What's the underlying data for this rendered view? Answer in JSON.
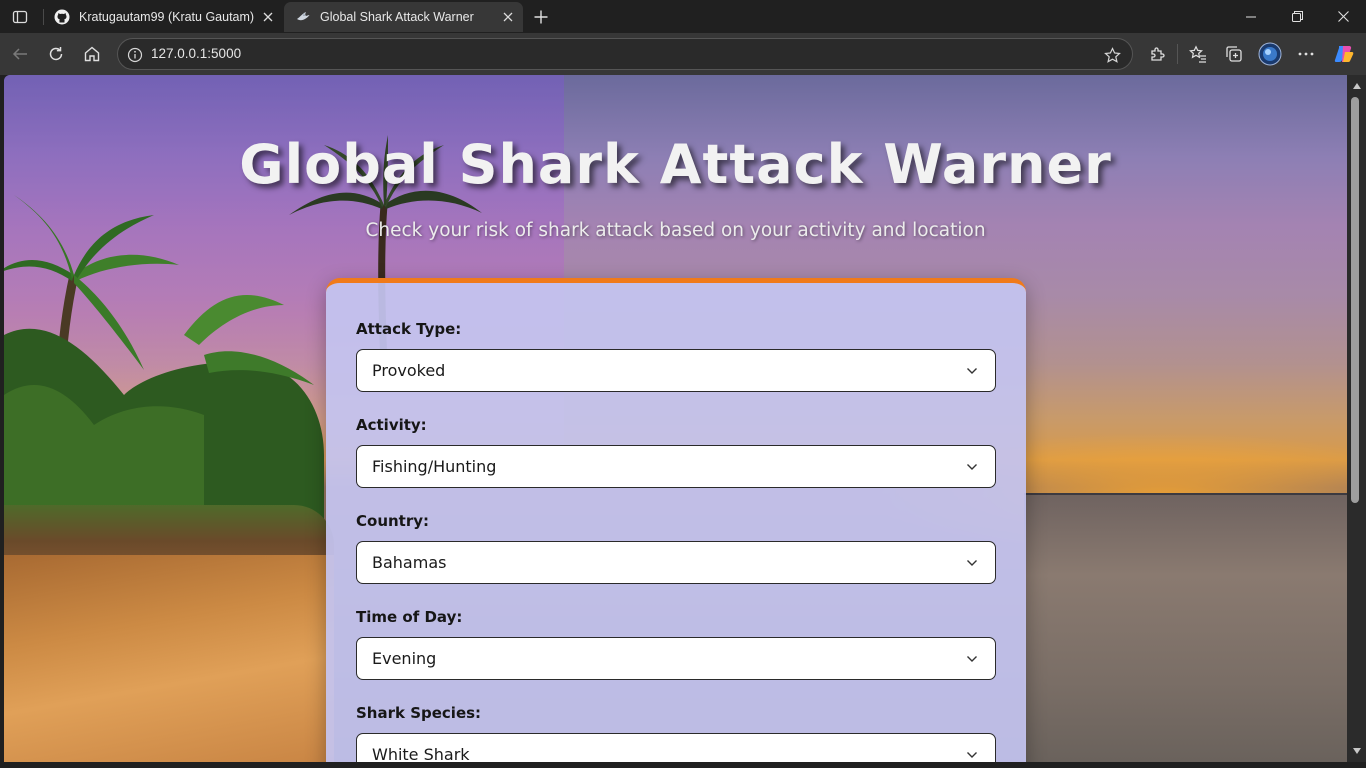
{
  "browser": {
    "tabs": [
      {
        "title": "Kratugautam99 (Kratu Gautam)",
        "icon": "github-icon",
        "active": false
      },
      {
        "title": "Global Shark Attack Warner",
        "icon": "shark-icon",
        "active": true
      }
    ],
    "url": "127.0.0.1:5000"
  },
  "page": {
    "title": "Global Shark Attack Warner",
    "subtitle": "Check your risk of shark attack based on your activity and location",
    "accent_color": "#f07a1a",
    "form": {
      "fields": [
        {
          "label": "Attack Type:",
          "value": "Provoked"
        },
        {
          "label": "Activity:",
          "value": "Fishing/Hunting"
        },
        {
          "label": "Country:",
          "value": "Bahamas"
        },
        {
          "label": "Time of Day:",
          "value": "Evening"
        },
        {
          "label": "Shark Species:",
          "value": "White Shark"
        }
      ]
    }
  }
}
